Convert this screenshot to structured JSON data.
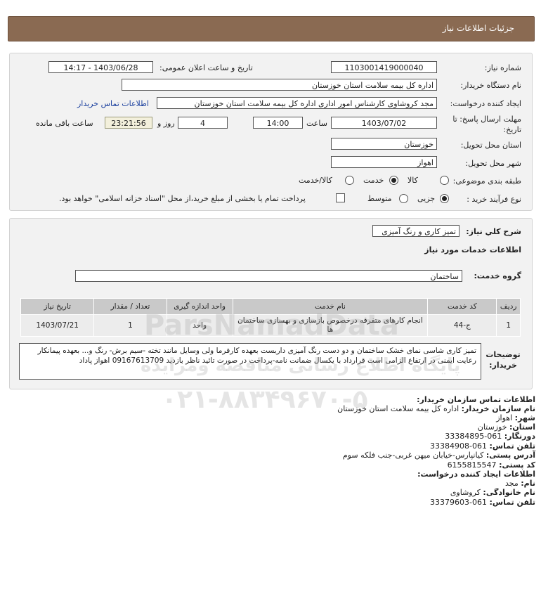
{
  "header": {
    "title": "جزئیات اطلاعات نیاز"
  },
  "form": {
    "need_number_label": "شماره نیاز:",
    "need_number": "1103001419000040",
    "announce_label": "تاریخ و ساعت اعلان عمومی:",
    "announce_value": "1403/06/28 - 14:17",
    "buyer_label": "نام دستگاه خریدار:",
    "buyer_value": "اداره کل بیمه سلامت استان خوزستان",
    "creator_label": "ایجاد کننده درخواست:",
    "creator_value": "مجد کروشاوی کارشناس امور اداری اداره کل بیمه سلامت استان خوزستان",
    "contact_link": "اطلاعات تماس خریدار",
    "deadline_label_1": "مهلت ارسال پاسخ: تا",
    "deadline_label_2": "تاریخ:",
    "deadline_date": "1403/07/02",
    "time_label": "ساعت",
    "deadline_time": "14:00",
    "days_value": "4",
    "days_label": "روز و",
    "remaining_value": "23:21:56",
    "remaining_label": "ساعت باقی مانده",
    "province_label": "استان محل تحویل:",
    "province_value": "خوزستان",
    "city_label": "شهر محل تحویل:",
    "city_value": "اهواز",
    "category_label": "طبقه بندی موضوعی:",
    "category_options": [
      "کالا",
      "خدمت",
      "کالا/خدمت"
    ],
    "category_selected": "خدمت",
    "process_label": "نوع فرآیند خرید :",
    "process_options": [
      "جزیی",
      "متوسط"
    ],
    "process_selected": "جزیی",
    "treasury_text": "پرداخت تمام یا بخشی از مبلغ خرید،از محل \"اسناد خزانه اسلامی\" خواهد بود.",
    "treasury_checked": false
  },
  "general": {
    "summary_label": "شرح کلي نياز:",
    "summary_value": "تمیز کاری و رنگ آمیزی",
    "services_title": "اطلاعات خدمات مورد نیاز",
    "group_label": "گروه خدمت:",
    "group_value": "ساختمان"
  },
  "table": {
    "headers": [
      "ردیف",
      "کد خدمت",
      "نام خدمت",
      "واحد اندازه گیری",
      "تعداد / مقدار",
      "تاریخ نیاز"
    ],
    "rows": [
      [
        "1",
        "ج-44",
        "انجام کارهای متفرقه درخصوص بازسازی و بهسازی ساختمان ها",
        "واحد",
        "1",
        "1403/07/21"
      ]
    ]
  },
  "description": {
    "label": "توضیحات خریدار:",
    "text": "تمیز کاری شاسی نمای خشک ساختمان و دو دست رنگ آمیزی داربست بعهده کارفرما ولی وسایل مانند تخته -سیم برش- رنگ و... بعهده پیمانکار رعایت ایمنی در ارتفاع الزامی است قرارداد با یکسال ضمانت نامه-پرداخت در صورت تائید ناظر بازدید 09167613709 اهواز پاداد"
  },
  "contact": {
    "org_title": "اطلاعات تماس سازمان خریدار:",
    "org_name_label": "نام سازمان خریدار:",
    "org_name": "اداره کل بیمه سلامت استان خوزستان",
    "city_label": "شهر:",
    "city": "اهواز",
    "province_label": "استان:",
    "province": "خوزستان",
    "fax_label": "دورنگار:",
    "fax": "061-33384895",
    "phone_label": "تلفن تماس:",
    "phone": "061-33384908",
    "address_label": "آدرس پستی:",
    "address": "کیانپارس-خیابان میهن غربی-جنب فلکه سوم",
    "postal_label": "کد پستی:",
    "postal": "6155815547",
    "creator_title": "اطلاعات ایجاد کننده درخواست:",
    "name_label": "نام:",
    "name": "مجد",
    "family_label": "نام خانوادگی:",
    "family": "کروشاوی",
    "creator_phone_label": "تلفن تماس:",
    "creator_phone": "061-33379603"
  },
  "watermark": {
    "brand": "ParsNamadData",
    "tagline": "پایگاه اطلاع رسانی مناقصه ومزایده",
    "phone": "۰۲۱-۸۸۳۴۹۶۷۰-۵"
  }
}
